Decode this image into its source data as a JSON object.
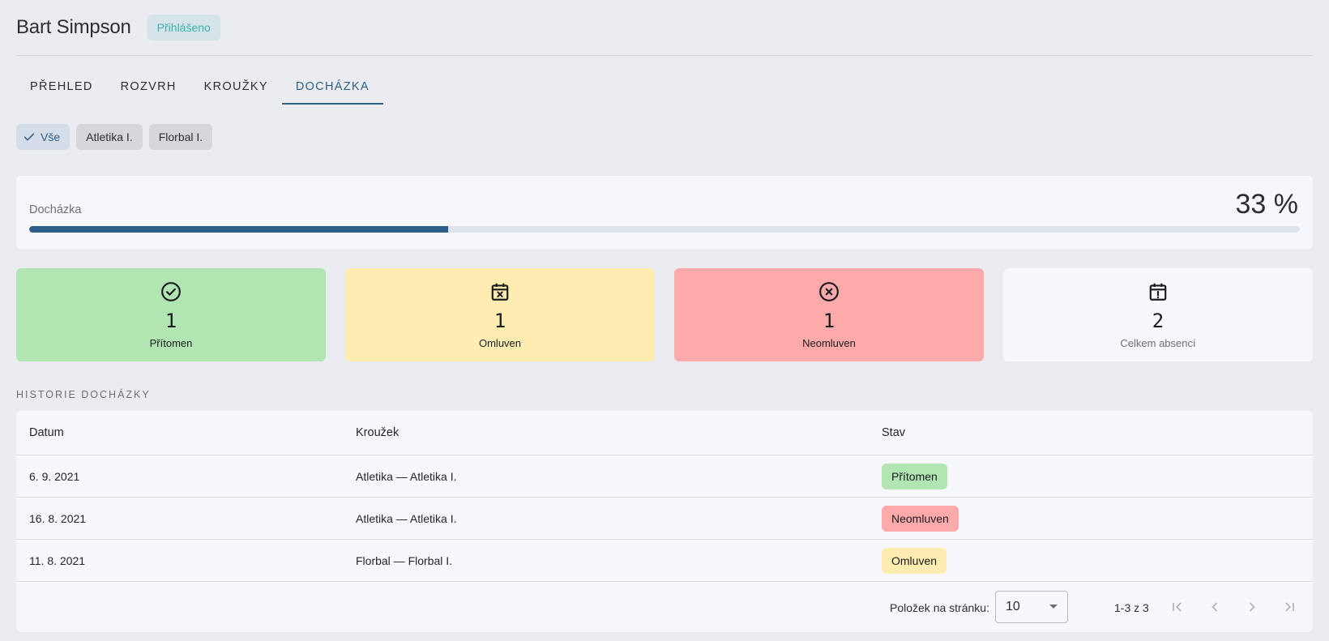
{
  "header": {
    "student_name": "Bart Simpson",
    "login_status": "Přihlášeno"
  },
  "tabs": [
    {
      "label": "PŘEHLED",
      "active": false
    },
    {
      "label": "ROZVRH",
      "active": false
    },
    {
      "label": "KROUŽKY",
      "active": false
    },
    {
      "label": "DOCHÁZKA",
      "active": true
    }
  ],
  "filters": [
    {
      "label": "Vše",
      "selected": true,
      "icon": "check-icon"
    },
    {
      "label": "Atletika I.",
      "selected": false
    },
    {
      "label": "Florbal I.",
      "selected": false
    }
  ],
  "attendance": {
    "label": "Docházka",
    "percent_text": "33 %",
    "progress_fraction": 0.33
  },
  "stats": [
    {
      "count": "1",
      "label": "Přítomen",
      "icon": "check-circle-icon",
      "color": "#b1e5b2"
    },
    {
      "count": "1",
      "label": "Omluven",
      "icon": "calendar-x-icon",
      "color": "#feecb1"
    },
    {
      "count": "1",
      "label": "Neomluven",
      "icon": "x-circle-icon",
      "color": "#fea9aa"
    },
    {
      "count": "2",
      "label": "Celkem absencí",
      "icon": "calendar-alert-icon",
      "color": "#f7f8fb"
    }
  ],
  "history": {
    "title": "HISTORIE DOCHÁZKY",
    "columns": [
      "Datum",
      "Kroužek",
      "Stav"
    ],
    "rows": [
      {
        "date": "6. 9. 2021",
        "club": "Atletika — Atletika I.",
        "status": "Přítomen",
        "status_color": "#b1e5b2"
      },
      {
        "date": "16. 8. 2021",
        "club": "Atletika — Atletika I.",
        "status": "Neomluven",
        "status_color": "#fea9aa"
      },
      {
        "date": "11. 8. 2021",
        "club": "Florbal — Florbal I.",
        "status": "Omluven",
        "status_color": "#feecb1"
      }
    ]
  },
  "pagination": {
    "per_page_label": "Položek na stránku:",
    "per_page_value": "10",
    "range_text": "1-3 z 3"
  },
  "colors": {
    "accent": "#2e5f89",
    "present": "#b1e5b2",
    "excused": "#feecb1",
    "unexcused": "#fea9aa"
  }
}
